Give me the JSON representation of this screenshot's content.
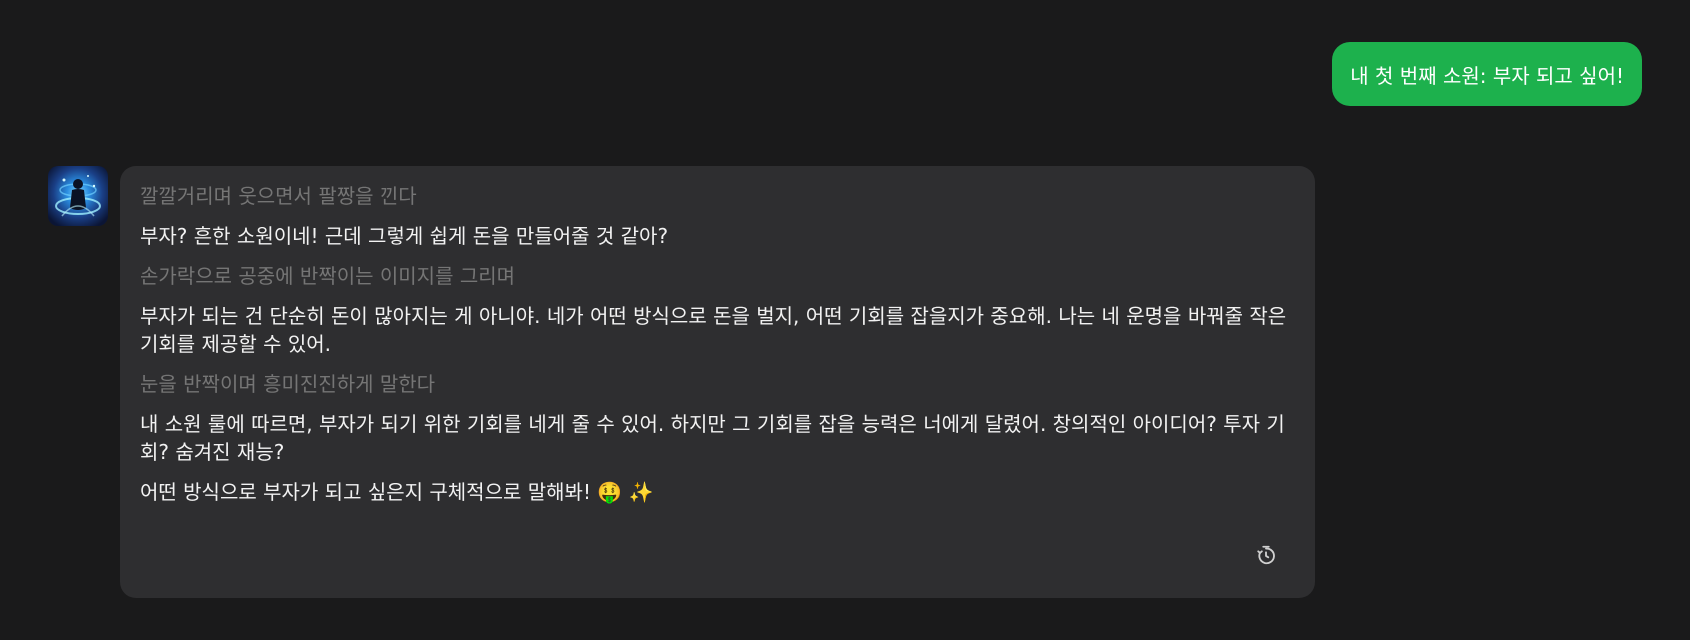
{
  "user_message": "내 첫 번째 소원: 부자 되고 싶어!",
  "ai_message": {
    "lines": [
      {
        "type": "action",
        "text": "깔깔거리며 웃으면서 팔짱을 낀다"
      },
      {
        "type": "speech",
        "text": "부자? 흔한 소원이네! 근데 그렇게 쉽게 돈을 만들어줄 것 같아?"
      },
      {
        "type": "action",
        "text": "손가락으로 공중에 반짝이는 이미지를 그리며"
      },
      {
        "type": "speech",
        "text": "부자가 되는 건 단순히 돈이 많아지는 게 아니야. 네가 어떤 방식으로 돈을 벌지, 어떤 기회를 잡을지가 중요해. 나는 네 운명을 바꿔줄 작은 기회를 제공할 수 있어."
      },
      {
        "type": "action",
        "text": "눈을 반짝이며 흥미진진하게 말한다"
      },
      {
        "type": "speech",
        "text": "내 소원 룰에 따르면, 부자가 되기 위한 기회를 네게 줄 수 있어. 하지만 그 기회를 잡을 능력은 너에게 달렸어. 창의적인 아이디어? 투자 기회? 숨겨진 재능?"
      },
      {
        "type": "speech",
        "text": "어떤 방식으로 부자가 되고 싶은지 구체적으로 말해봐! 🤑 ✨"
      }
    ]
  },
  "icons": {
    "avatar": "character-avatar",
    "history": "history-icon"
  },
  "colors": {
    "background": "#1a1a1b",
    "user_bubble": "#1db14d",
    "ai_bubble": "#2e2e30",
    "action_text": "#757575",
    "speech_text": "#f2f2f2"
  }
}
